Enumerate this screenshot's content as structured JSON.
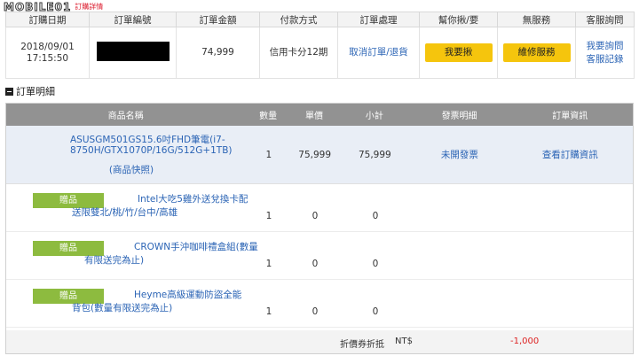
{
  "logo": {
    "text": "MOBILE01",
    "sub": "訂購詳情"
  },
  "order": {
    "headers": [
      "訂購日期",
      "訂單編號",
      "訂單金額",
      "付款方式",
      "訂單處理",
      "幫你揪/要",
      "無服務",
      "客服詢問"
    ],
    "date_line1": "2018/09/01",
    "date_line2": "17:15:50",
    "amount": "74,999",
    "payment": "信用卡分12期",
    "action_cancel": "取消訂單/退貨",
    "btn_want": "我要揪",
    "btn_repair": "維修服務",
    "link_ask": "我要詢問",
    "link_records": "客服記錄"
  },
  "section": {
    "title": "訂單明細"
  },
  "detail": {
    "headers": {
      "name": "商品名稱",
      "qty": "數量",
      "price": "單價",
      "subtotal": "小計",
      "invoice": "發票明細",
      "info": "訂單資訊"
    },
    "main": {
      "name": "ASUSGM501GS15.6吋FHD筆電(i7-8750H/GTX1070P/16G/512G+1TB)",
      "snapshot": "(商品快照)",
      "qty": "1",
      "price": "75,999",
      "subtotal": "75,999",
      "invoice": "未開發票",
      "info": "查看訂購資訊"
    },
    "gifts": [
      {
        "badge": "贈品",
        "name": "Intel大吃5雞外送兌換卡配送限雙北/桃/竹/台中/高雄",
        "qty": "1",
        "price": "0",
        "subtotal": "0"
      },
      {
        "badge": "贈品",
        "name": "CROWN手沖咖啡禮盒組(數量有限送完為止)",
        "qty": "1",
        "price": "0",
        "subtotal": "0"
      },
      {
        "badge": "贈品",
        "name": "Heyme高級運動防盜全能背包(數量有限送完為止)",
        "qty": "1",
        "price": "0",
        "subtotal": "0"
      }
    ],
    "footer": {
      "label": "折價券折抵",
      "currency": "NT$",
      "value": "-1,000"
    }
  }
}
